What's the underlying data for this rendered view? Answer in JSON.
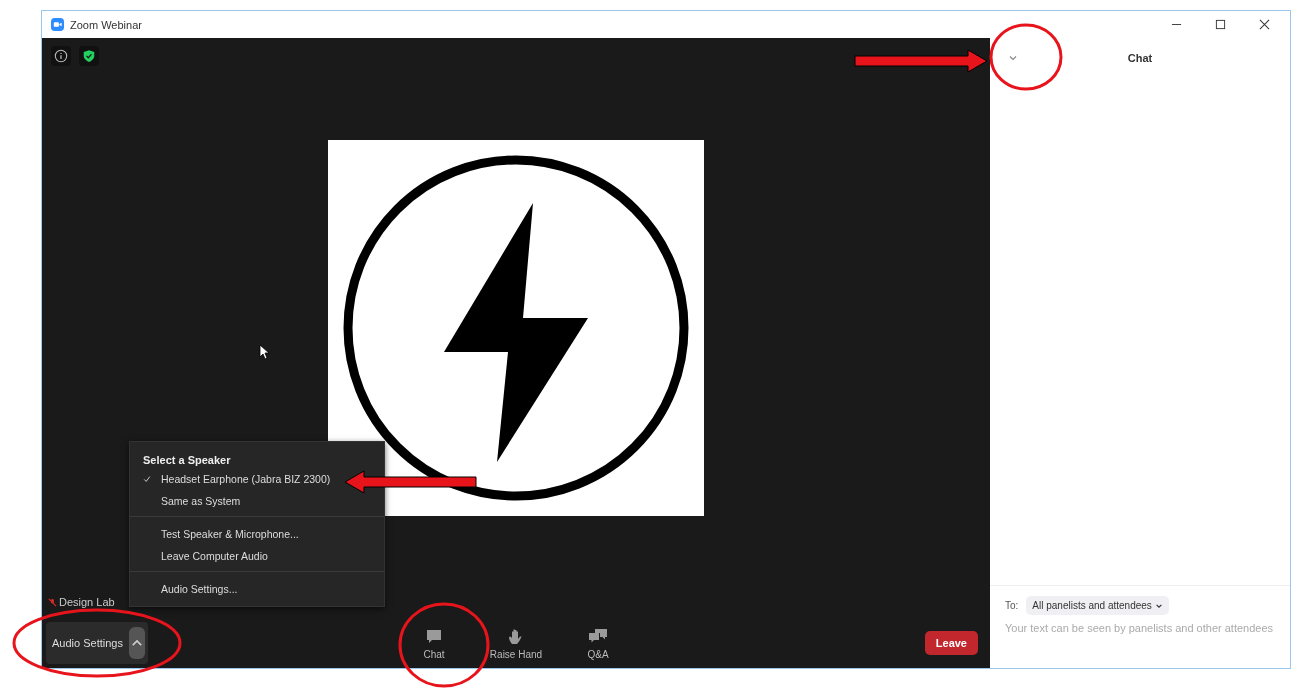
{
  "window": {
    "title": "Zoom Webinar"
  },
  "video": {
    "participant_name": "Design Lab",
    "mic_muted": true
  },
  "speaker_menu": {
    "heading": "Select a Speaker",
    "speakers": [
      {
        "label": "Headset Earphone (Jabra BIZ 2300)",
        "selected": true
      },
      {
        "label": "Same as System",
        "selected": false
      }
    ],
    "action_groups": [
      [
        "Test Speaker & Microphone...",
        "Leave Computer Audio"
      ],
      [
        "Audio Settings..."
      ]
    ]
  },
  "toolbar": {
    "audio_button": "Audio Settings",
    "items": [
      {
        "label": "Chat",
        "kind": "chat"
      },
      {
        "label": "Raise Hand",
        "kind": "hand"
      },
      {
        "label": "Q&A",
        "kind": "qa"
      }
    ],
    "leave": "Leave"
  },
  "chat": {
    "title": "Chat",
    "to_label": "To:",
    "recipient": "All panelists and attendees",
    "placeholder": "Your text can be seen by panelists and other attendees"
  }
}
